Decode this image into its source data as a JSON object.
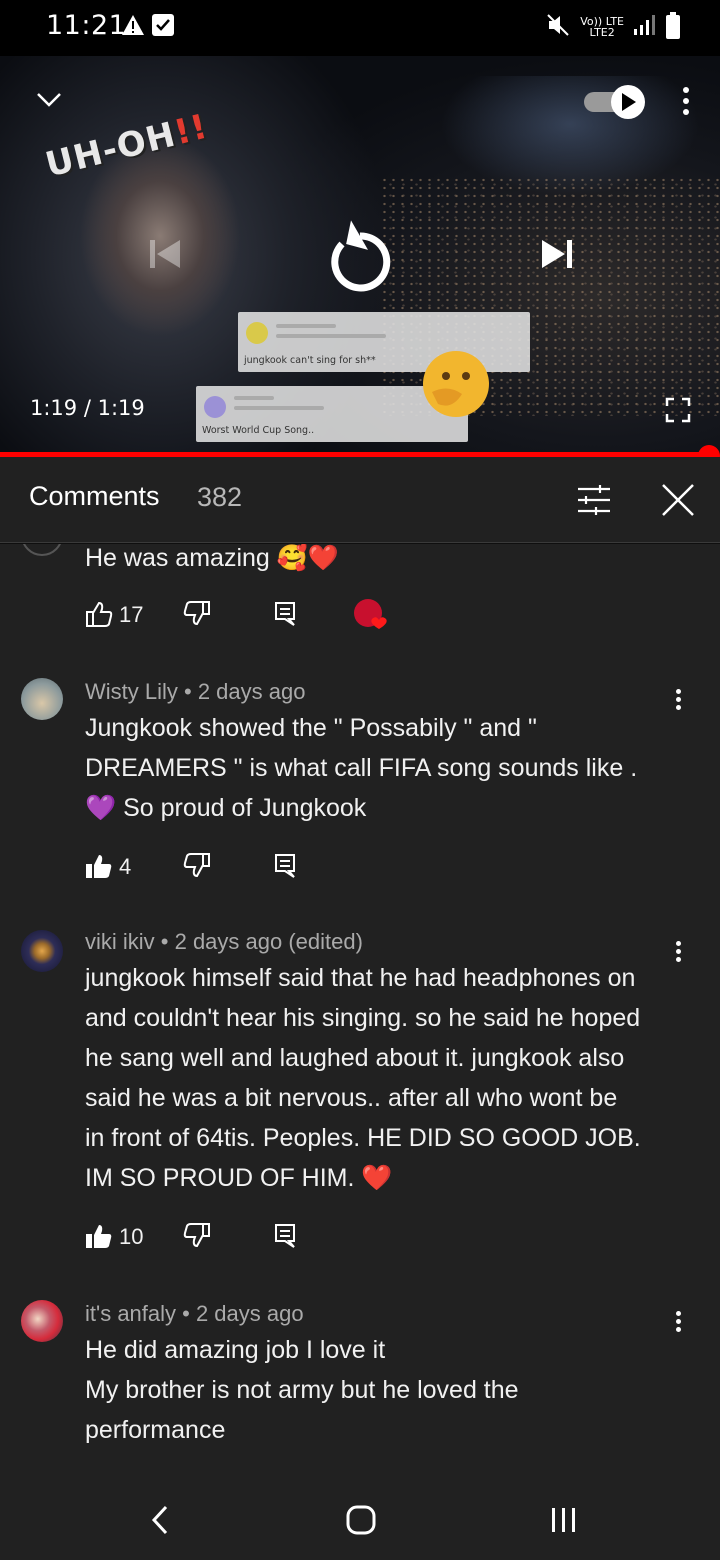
{
  "status_bar": {
    "time": "11:21",
    "network_top": "Vo)) LTE",
    "network_bottom": "LTE2"
  },
  "player": {
    "overlay_text": "UH-OH",
    "overlay_exclaim": "!!",
    "time_display": "1:19 / 1:19",
    "card1_text": "jungkook can't sing for sh**",
    "card2_text": "Worst World Cup Song..",
    "progress_fraction": 1.0,
    "autoplay": "on"
  },
  "comments_header": {
    "title": "Comments",
    "count": "382"
  },
  "comments": [
    {
      "body": "He was amazing 🥰❤️",
      "likes": "17"
    },
    {
      "author": "Wisty Lily",
      "age": "2 days ago",
      "meta": "Wisty Lily • 2 days ago",
      "body_lines": [
        "Jungkook showed the \" Possabily \" and \"",
        "DREAMERS \" is what call FIFA song sounds like .",
        "💜 So proud of Jungkook"
      ],
      "likes": "4"
    },
    {
      "author": "viki ikiv",
      "age": "2 days ago (edited)",
      "meta": "viki ikiv • 2 days ago (edited)",
      "body_lines": [
        "jungkook himself said that he had headphones on",
        "and couldn't hear his singing. so he said he hoped",
        "he sang well and laughed about it. jungkook also",
        "said he was a bit nervous.. after all who wont be",
        "in front of 64tis. Peoples. HE DID SO GOOD JOB.",
        "IM SO PROUD OF HIM. ❤️"
      ],
      "likes": "10"
    },
    {
      "author": "it's anfaly",
      "age": "2 days ago",
      "meta": "it's anfaly • 2 days ago",
      "body_lines": [
        "He did amazing job I love it",
        "My brother is not army but he loved the",
        "performance"
      ]
    }
  ],
  "colors": {
    "background": "#212121",
    "progress": "#ff0000",
    "meta_text": "#aaaaaa"
  }
}
